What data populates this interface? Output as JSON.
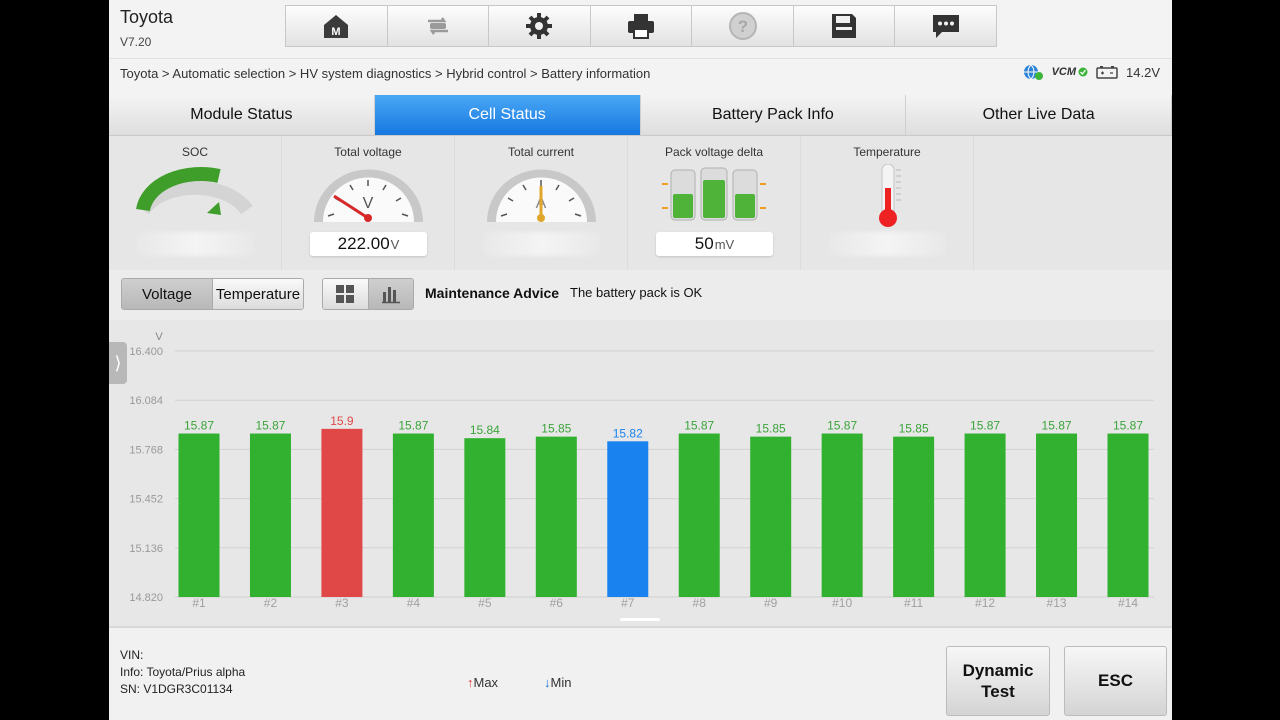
{
  "app": {
    "title": "Toyota",
    "version": "V7.20"
  },
  "toolbar": {
    "icons": [
      "home-icon",
      "vehicle-swap-icon",
      "settings-gear-icon",
      "printer-icon",
      "help-icon",
      "save-icon",
      "message-icon"
    ]
  },
  "breadcrumb": "Toyota > Automatic selection > HV system diagnostics > Hybrid control > Battery information",
  "status": {
    "vcm_label": "VCM",
    "battery_voltage": "14.2V"
  },
  "tabs": [
    {
      "label": "Module Status",
      "active": false
    },
    {
      "label": "Cell Status",
      "active": true
    },
    {
      "label": "Battery Pack Info",
      "active": false
    },
    {
      "label": "Other Live Data",
      "active": false
    }
  ],
  "gauges": {
    "soc": {
      "label": "SOC"
    },
    "total_voltage": {
      "label": "Total voltage",
      "value": "222.00",
      "unit": "V",
      "dial_letter": "V"
    },
    "total_current": {
      "label": "Total current",
      "dial_letter": "A"
    },
    "pack_delta": {
      "label": "Pack voltage delta",
      "value": "50",
      "unit": "mV"
    },
    "temperature": {
      "label": "Temperature"
    }
  },
  "controls": {
    "toggles": [
      {
        "label": "Voltage",
        "active": true
      },
      {
        "label": "Temperature",
        "active": false
      }
    ],
    "advice_label": "Maintenance Advice",
    "advice_text": "The battery pack is OK"
  },
  "chart_data": {
    "type": "bar",
    "ylabel": "V",
    "ylim": [
      14.82,
      16.4
    ],
    "yticks": [
      "16.400",
      "16.084",
      "15.768",
      "15.452",
      "15.136",
      "14.820"
    ],
    "categories": [
      "#1",
      "#2",
      "#3",
      "#4",
      "#5",
      "#6",
      "#7",
      "#8",
      "#9",
      "#10",
      "#11",
      "#12",
      "#13",
      "#14"
    ],
    "values": [
      15.87,
      15.87,
      15.9,
      15.87,
      15.84,
      15.85,
      15.82,
      15.87,
      15.85,
      15.87,
      15.85,
      15.87,
      15.87,
      15.87
    ],
    "labels": [
      "15.87",
      "15.87",
      "15.9",
      "15.87",
      "15.84",
      "15.85",
      "15.82",
      "15.87",
      "15.85",
      "15.87",
      "15.85",
      "15.87",
      "15.87",
      "15.87"
    ],
    "max_index": 2,
    "min_index": 6,
    "colors": {
      "normal": "#31b12f",
      "max": "#e04848",
      "min": "#1a82ee",
      "label_normal": "#3aa43a",
      "label_max": "#e04848",
      "label_min": "#1a82ee"
    }
  },
  "footer": {
    "vin": "VIN:",
    "info": "Info: Toyota/Prius alpha",
    "sn": "SN: V1DGR3C01134",
    "legend_max": "Max",
    "legend_min": "Min",
    "dynamic_test_line1": "Dynamic",
    "dynamic_test_line2": "Test",
    "esc": "ESC"
  }
}
